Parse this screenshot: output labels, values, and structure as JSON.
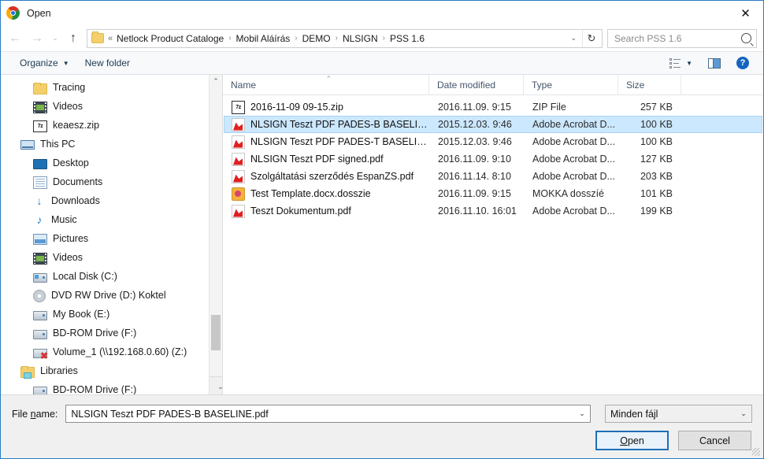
{
  "window": {
    "title": "Open",
    "app_icon": "chrome-logo-icon",
    "close_label": "✕",
    "border_color": "#2a7cc7"
  },
  "nav": {
    "back_icon": "←",
    "forward_icon": "→",
    "history_icon": "⌄",
    "up_icon": "↑",
    "refresh_icon": "↻",
    "double_chevron": "«",
    "dropdown_icon": "⌄",
    "breadcrumbs": [
      "Netlock Product Cataloge",
      "Mobil Aláírás",
      "DEMO",
      "NLSIGN",
      "PSS 1.6"
    ],
    "separator": "›"
  },
  "search": {
    "placeholder": "Search PSS 1.6",
    "value": "",
    "icon": "search-icon"
  },
  "toolbar": {
    "organize_label": "Organize",
    "organize_caret": "▼",
    "new_folder_label": "New folder",
    "view_icon": "list-view-icon",
    "view_caret": "▼",
    "preview_pane_icon": "preview-pane-icon",
    "help_icon": "?"
  },
  "sidebar": {
    "items": [
      {
        "label": "Tracing",
        "icon": "folder-icon",
        "indent": 2
      },
      {
        "label": "Videos",
        "icon": "videos-icon",
        "indent": 2
      },
      {
        "label": "keaesz.zip",
        "icon": "7zip-icon",
        "indent": 2
      },
      {
        "label": "This PC",
        "icon": "this-pc-icon",
        "indent": 1
      },
      {
        "label": "Desktop",
        "icon": "desktop-icon",
        "indent": 2
      },
      {
        "label": "Documents",
        "icon": "documents-icon",
        "indent": 2
      },
      {
        "label": "Downloads",
        "icon": "downloads-icon",
        "indent": 2
      },
      {
        "label": "Music",
        "icon": "music-icon",
        "indent": 2
      },
      {
        "label": "Pictures",
        "icon": "pictures-icon",
        "indent": 2
      },
      {
        "label": "Videos",
        "icon": "videos-icon",
        "indent": 2
      },
      {
        "label": "Local Disk (C:)",
        "icon": "local-disk-icon",
        "indent": 2
      },
      {
        "label": "DVD RW Drive (D:) Koktel",
        "icon": "dvd-drive-icon",
        "indent": 2
      },
      {
        "label": "My Book (E:)",
        "icon": "hard-drive-icon",
        "indent": 2
      },
      {
        "label": "BD-ROM Drive (F:)",
        "icon": "bd-rom-icon",
        "indent": 2
      },
      {
        "label": "Volume_1 (\\\\192.168.0.60) (Z:)",
        "icon": "network-drive-disconnected-icon",
        "indent": 2
      },
      {
        "label": "Libraries",
        "icon": "libraries-icon",
        "indent": 1
      },
      {
        "label": "BD-ROM Drive (F:)",
        "icon": "bd-rom-icon",
        "indent": 2
      }
    ],
    "scroll_up_icon": "⌃",
    "scroll_down_icon": "⌄"
  },
  "filelist": {
    "columns": [
      {
        "key": "name",
        "label": "Name",
        "sorted": "asc",
        "sort_icon": "⌃"
      },
      {
        "key": "date",
        "label": "Date modified"
      },
      {
        "key": "type",
        "label": "Type"
      },
      {
        "key": "size",
        "label": "Size"
      }
    ],
    "rows": [
      {
        "name": "2016-11-09 09-15.zip",
        "date": "2016.11.09. 9:15",
        "type": "ZIP File",
        "size": "257 KB",
        "icon": "7zip-file-icon",
        "selected": false
      },
      {
        "name": "NLSIGN Teszt PDF PADES-B BASELINE.pdf",
        "date": "2015.12.03. 9:46",
        "type": "Adobe Acrobat D...",
        "size": "100 KB",
        "icon": "pdf-file-icon",
        "selected": true
      },
      {
        "name": "NLSIGN Teszt PDF PADES-T BASELINE.pdf",
        "date": "2015.12.03. 9:46",
        "type": "Adobe Acrobat D...",
        "size": "100 KB",
        "icon": "pdf-file-icon",
        "selected": false
      },
      {
        "name": "NLSIGN Teszt PDF signed.pdf",
        "date": "2016.11.09. 9:10",
        "type": "Adobe Acrobat D...",
        "size": "127 KB",
        "icon": "pdf-file-icon",
        "selected": false
      },
      {
        "name": "Szolgáltatási szerződés EspanZS.pdf",
        "date": "2016.11.14. 8:10",
        "type": "Adobe Acrobat D...",
        "size": "203 KB",
        "icon": "pdf-file-icon",
        "selected": false
      },
      {
        "name": "Test Template.docx.dosszie",
        "date": "2016.11.09. 9:15",
        "type": "MOKKA dosszíé",
        "size": "101 KB",
        "icon": "mokka-file-icon",
        "selected": false
      },
      {
        "name": "Teszt Dokumentum.pdf",
        "date": "2016.11.10. 16:01",
        "type": "Adobe Acrobat D...",
        "size": "199 KB",
        "icon": "pdf-file-icon",
        "selected": false
      }
    ],
    "selection_color": "#cce8ff"
  },
  "footer": {
    "filename_label_pre": "File ",
    "filename_label_accel": "n",
    "filename_label_post": "ame:",
    "filename_value": "NLSIGN Teszt PDF PADES-B BASELINE.pdf",
    "filename_caret": "⌄",
    "filter_value": "Minden fájl",
    "filter_caret": "⌄",
    "open_pre": "",
    "open_accel": "O",
    "open_post": "pen",
    "cancel_label": "Cancel",
    "accent_color": "#1f6fb5"
  }
}
